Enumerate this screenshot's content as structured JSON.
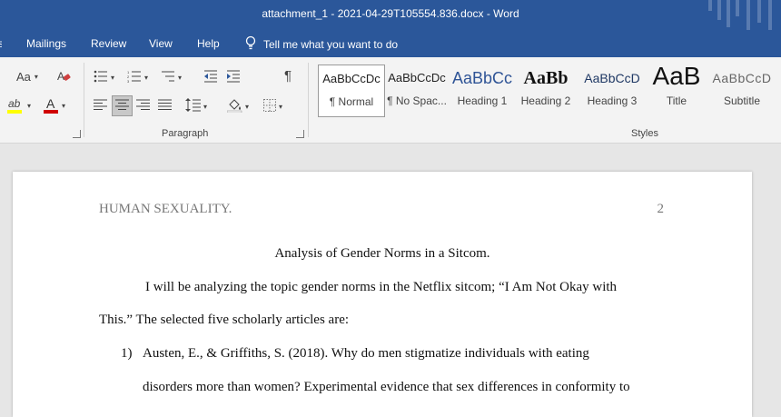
{
  "window": {
    "title": "attachment_1 - 2021-04-29T105554.836.docx  -  Word"
  },
  "menu": {
    "items": [
      "Mailings",
      "Review",
      "View",
      "Help"
    ],
    "tell_me": "Tell me what you want to do"
  },
  "ribbon": {
    "font_group": {
      "change_case": "Aa",
      "font_color_letter": "A",
      "highlight_letters": "ab"
    },
    "paragraph": {
      "label": "Paragraph",
      "pilcrow": "¶"
    },
    "styles": {
      "label": "Styles",
      "items": [
        {
          "preview": "AaBbCcDc",
          "name": "¶ Normal"
        },
        {
          "preview": "AaBbCcDc",
          "name": "¶ No Spac..."
        },
        {
          "preview": "AaBbCc",
          "name": "Heading 1"
        },
        {
          "preview": "AaBb",
          "name": "Heading 2"
        },
        {
          "preview": "AaBbCcD",
          "name": "Heading 3"
        },
        {
          "preview": "AaB",
          "name": "Title"
        },
        {
          "preview": "AaBbCcD",
          "name": "Subtitle"
        }
      ]
    }
  },
  "colors": {
    "brand": "#2b579a",
    "font_color": "#d00000",
    "highlight": "#ffff00"
  },
  "document": {
    "header_left": "HUMAN SEXUALITY.",
    "header_right": "2",
    "title": "Analysis of Gender Norms in a Sitcom.",
    "para1_line1": "I will be analyzing the topic gender norms in the Netflix sitcom; “I Am Not Okay with",
    "para1_line2": "This.” The selected five scholarly articles are:",
    "list_num": "1)",
    "item1_line1": "Austen, E., & Griffiths, S. (2018). Why do men stigmatize individuals with eating",
    "item1_line2": "disorders more than women? Experimental evidence that sex differences in conformity to"
  }
}
